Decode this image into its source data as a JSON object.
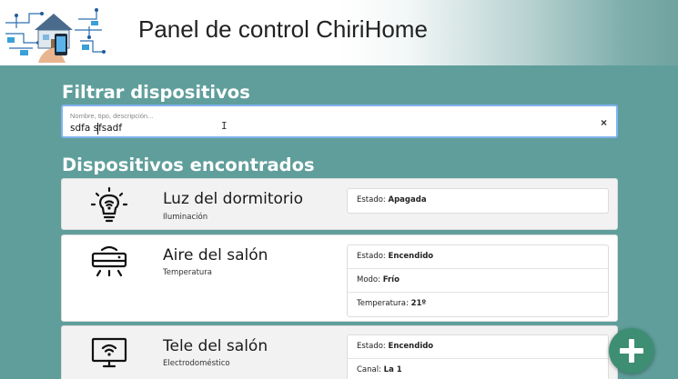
{
  "header": {
    "title": "Panel de control ChiriHome",
    "logo_icon": "smart-home-logo"
  },
  "filter": {
    "heading": "Filtrar dispositivos",
    "placeholder": "Nombre, tipo, descripción...",
    "value": "sdfa sfsadf",
    "clear_label": "×"
  },
  "results": {
    "heading": "Dispositivos encontrados",
    "devices": [
      {
        "name": "Luz del dormitorio",
        "type": "Iluminación",
        "icon": "lightbulb-icon",
        "props": [
          {
            "label": "Estado: ",
            "value": "Apagada"
          }
        ]
      },
      {
        "name": "Aire del salón",
        "type": "Temperatura",
        "icon": "air-conditioner-icon",
        "props": [
          {
            "label": "Estado: ",
            "value": "Encendido"
          },
          {
            "label": "Modo: ",
            "value": "Frío"
          },
          {
            "label": "Temperatura: ",
            "value": "21º"
          }
        ]
      },
      {
        "name": "Tele del salón",
        "type": "Electrodoméstico",
        "icon": "smart-tv-icon",
        "props": [
          {
            "label": "Estado: ",
            "value": "Encendido"
          },
          {
            "label": "Canal: ",
            "value": "La 1"
          }
        ]
      }
    ]
  },
  "fab": {
    "icon": "plus-icon",
    "color": "#3e8e73"
  },
  "colors": {
    "background": "#5f9e9b",
    "focus_border": "#7fb3ee"
  }
}
